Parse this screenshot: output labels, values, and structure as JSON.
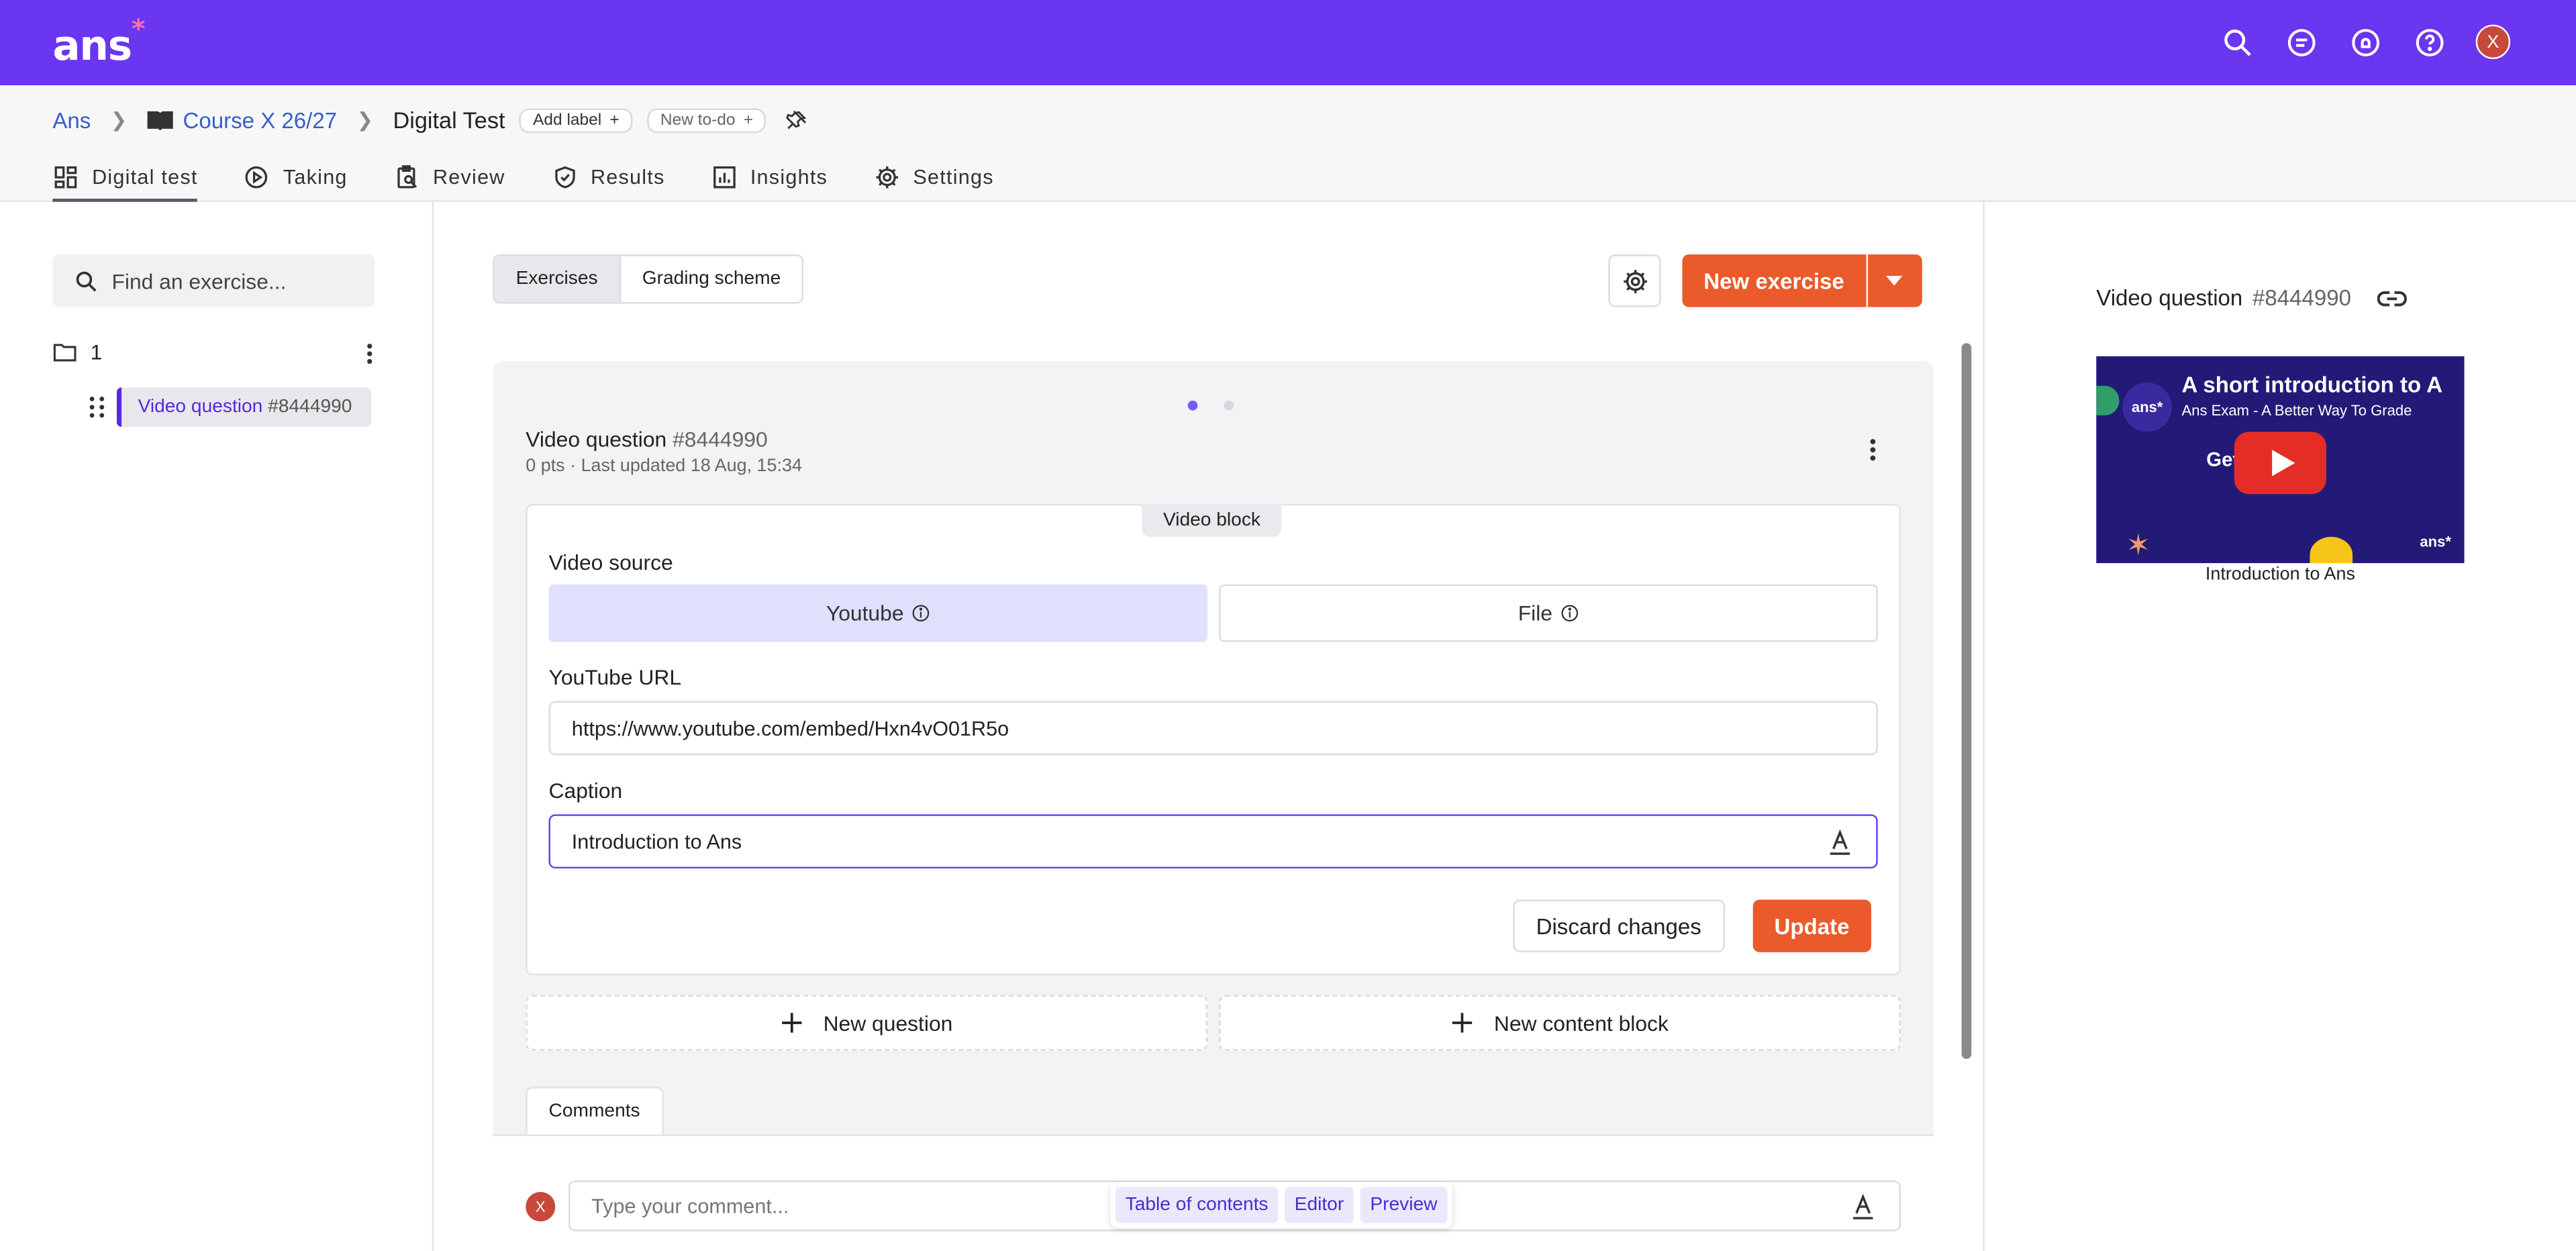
{
  "topbar": {
    "logo": "ans",
    "logo_mark": "*",
    "user_initial": "X",
    "icons": [
      "search-icon",
      "chat-icon",
      "bell-icon",
      "help-icon",
      "user-avatar"
    ]
  },
  "breadcrumb": {
    "root": "Ans",
    "course": "Course X 26/27",
    "current": "Digital Test",
    "add_label": "Add label",
    "new_todo": "New to-do"
  },
  "tabs": [
    {
      "label": "Digital test",
      "active": true
    },
    {
      "label": "Taking"
    },
    {
      "label": "Review"
    },
    {
      "label": "Results"
    },
    {
      "label": "Insights"
    },
    {
      "label": "Settings"
    }
  ],
  "sidebar": {
    "search_placeholder": "Find an exercise...",
    "folder_label": "1",
    "item_title": "Video question",
    "item_id": "#8444990"
  },
  "toolbar": {
    "seg_exercises": "Exercises",
    "seg_grading": "Grading scheme",
    "new_exercise": "New exercise"
  },
  "exercise": {
    "title": "Video question",
    "id": "#8444990",
    "meta": "0 pts · Last updated 18 Aug, 15:34",
    "block_tag": "Video block",
    "video_source_label": "Video source",
    "source_youtube": "Youtube",
    "source_file": "File",
    "youtube_url_label": "YouTube URL",
    "youtube_url": "https://www.youtube.com/embed/Hxn4vO01R5o",
    "caption_label": "Caption",
    "caption_value": "Introduction to Ans",
    "discard": "Discard changes",
    "update": "Update",
    "new_question": "New question",
    "new_content_block": "New content block",
    "comments_tab": "Comments",
    "comment_placeholder": "Type your comment...",
    "commenter_initial": "X"
  },
  "floating_tools": {
    "toc": "Table of contents",
    "editor": "Editor",
    "preview": "Preview"
  },
  "preview": {
    "title": "Video question",
    "id": "#8444990",
    "video_title": "A short introduction to A",
    "video_subtitle": "Ans Exam - A Better Way To Grade",
    "video_get": "Get started",
    "video_logo": "ans*",
    "caption": "Introduction to Ans"
  },
  "colors": {
    "brand": "#6a36f0",
    "accent": "#ea5a2a",
    "link": "#3a5ccc"
  }
}
